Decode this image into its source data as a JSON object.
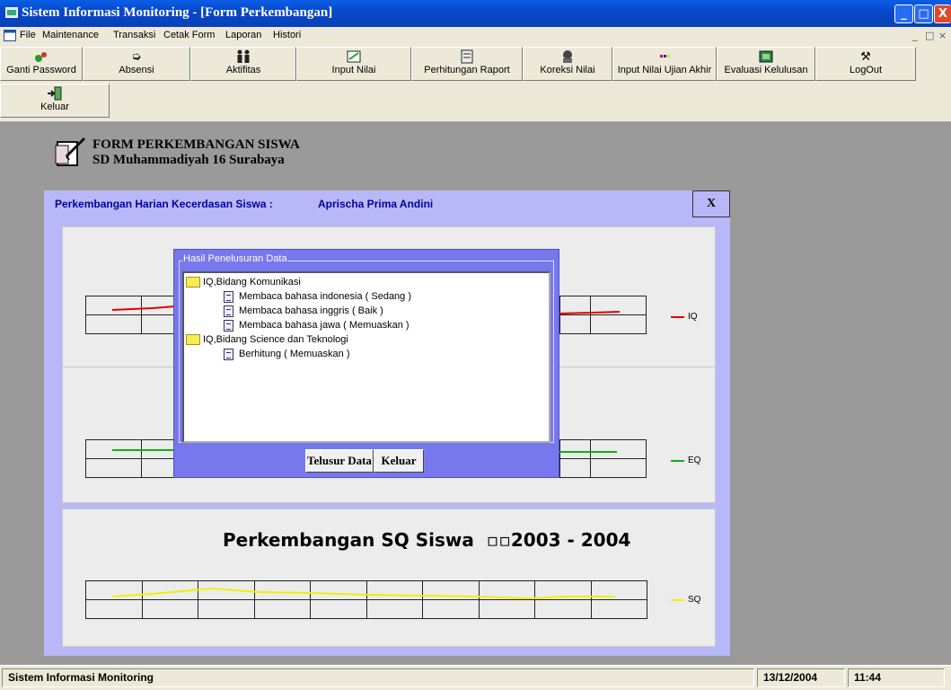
{
  "window": {
    "title": "Sistem Informasi Monitoring - [Form Perkembangan]",
    "min": "_",
    "max": "□",
    "close": "X"
  },
  "menu": {
    "items": [
      "File",
      "Maintenance",
      "Transaksi",
      "Cetak Form",
      "Laporan",
      "Histori"
    ],
    "mdi_min": "_",
    "mdi_restore": "□",
    "mdi_close": "×"
  },
  "toolbar": {
    "buttons": [
      {
        "label": "Ganti Password",
        "icon": "password-icon"
      },
      {
        "label": "Absensi",
        "icon": "attendance-icon"
      },
      {
        "label": "Aktifitas",
        "icon": "activity-icon"
      },
      {
        "label": "Input Nilai",
        "icon": "input-grade-icon"
      },
      {
        "label": "Perhitungan Raport",
        "icon": "report-calc-icon"
      },
      {
        "label": "Koreksi Nilai",
        "icon": "grade-correction-icon"
      },
      {
        "label": "Input Nilai Ujian Akhir",
        "icon": "final-exam-icon"
      },
      {
        "label": "Evaluasi Kelulusan",
        "icon": "graduation-eval-icon"
      },
      {
        "label": "LogOut",
        "icon": "tools-icon"
      },
      {
        "label": "Keluar",
        "icon": "exit-icon"
      }
    ]
  },
  "form": {
    "title": "FORM PERKEMBANGAN SISWA",
    "subtitle": "SD Muhammadiyah 16 Surabaya",
    "strip_label": "Perkembangan Harian Kecerdasan Siswa  :",
    "student_name": "Aprischa Prima Andini",
    "close_label": "X"
  },
  "charts": {
    "iq_legend": "IQ",
    "eq_legend": "EQ",
    "sq_title": "Perkembangan SQ Siswa",
    "sq_period": "▫▫2003 - 2004",
    "sq_legend": "SQ",
    "colors": {
      "iq": "#e00000",
      "eq": "#10b010",
      "sq": "#f0f000"
    }
  },
  "dialog": {
    "title": "Hasil Penelusuran Data",
    "tree": [
      {
        "level": 0,
        "type": "folder",
        "label": "IQ,Bidang Komunikasi"
      },
      {
        "level": 1,
        "type": "doc",
        "label": "Membaca bahasa indonesia ( Sedang )"
      },
      {
        "level": 1,
        "type": "doc",
        "label": "Membaca bahasa inggris ( Baik )"
      },
      {
        "level": 1,
        "type": "doc",
        "label": "Membaca bahasa jawa ( Memuaskan )"
      },
      {
        "level": 0,
        "type": "folder",
        "label": "IQ,Bidang Science dan Teknologi"
      },
      {
        "level": 1,
        "type": "doc",
        "label": "Berhitung ( Memuaskan )"
      }
    ],
    "search_button": "Telusur Data",
    "exit_button": "Keluar"
  },
  "status": {
    "app": "Sistem Informasi Monitoring",
    "date": "13/12/2004",
    "time": "11:44"
  }
}
